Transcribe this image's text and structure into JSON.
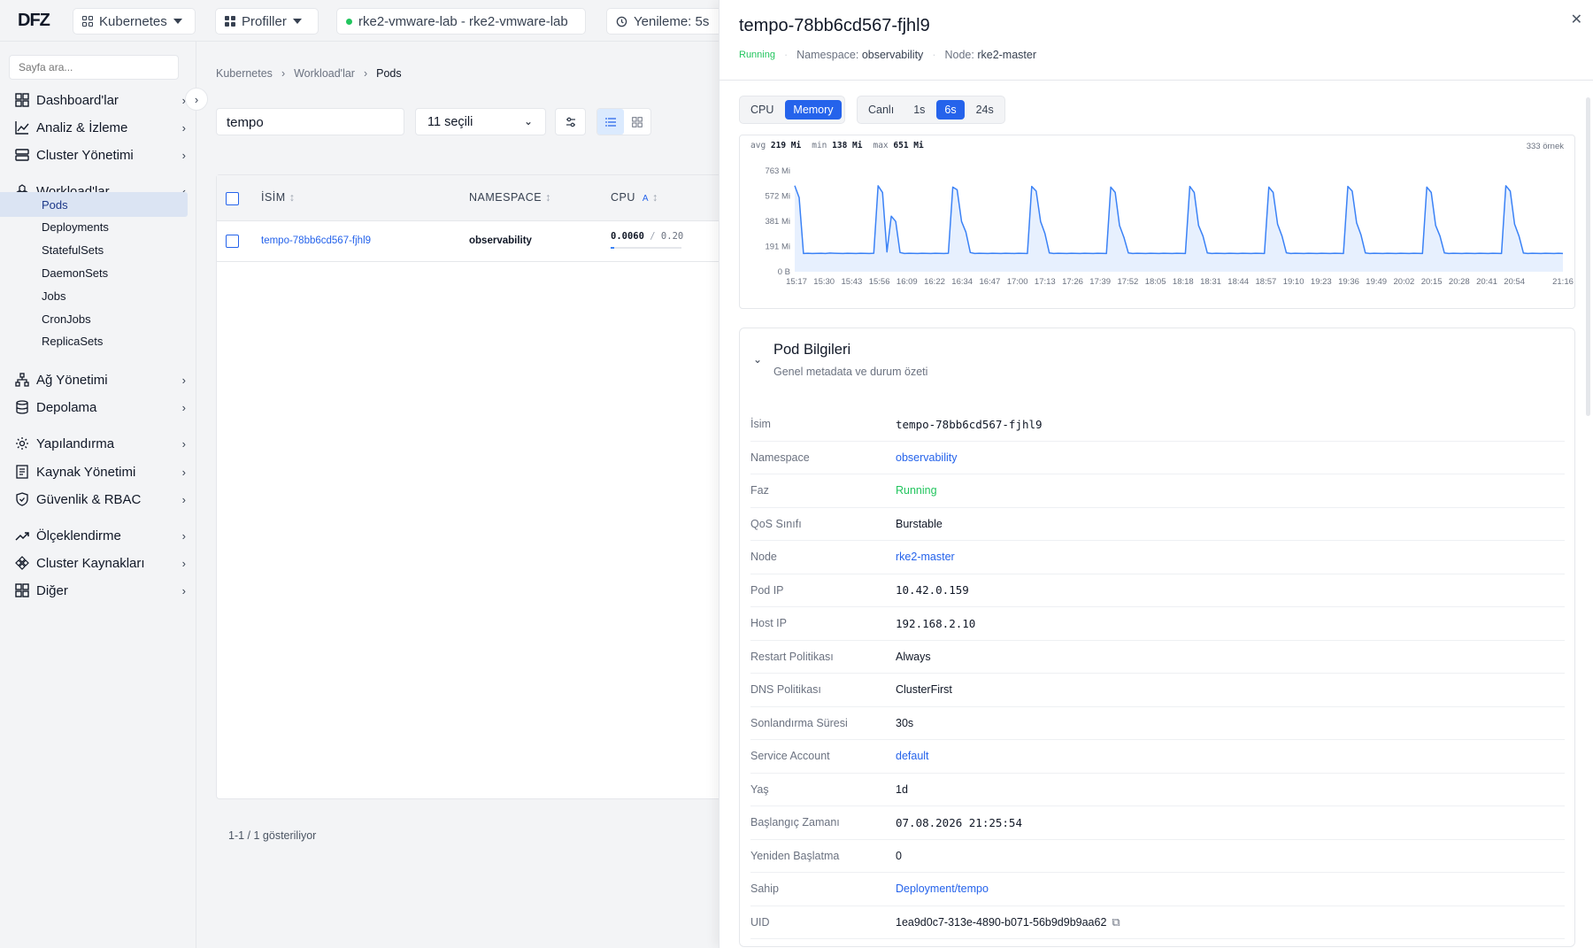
{
  "topbar": {
    "logo": "DFZ",
    "kubernetes_label": "Kubernetes",
    "profiles_label": "Profiller",
    "cluster_label": "rke2-vmware-lab - rke2-vmware-lab",
    "refresh_label": "Yenileme:  5s"
  },
  "sidebar": {
    "search_placeholder": "Sayfa ara...",
    "items": [
      {
        "label": "Dashboard'lar"
      },
      {
        "label": "Analiz & İzleme"
      },
      {
        "label": "Cluster Yönetimi"
      },
      {
        "label": "Workload'lar"
      },
      {
        "label": "Ağ Yönetimi"
      },
      {
        "label": "Depolama"
      },
      {
        "label": "Yapılandırma"
      },
      {
        "label": "Kaynak Yönetimi"
      },
      {
        "label": "Güvenlik & RBAC"
      },
      {
        "label": "Ölçeklendirme"
      },
      {
        "label": "Cluster Kaynakları"
      },
      {
        "label": "Diğer"
      }
    ],
    "workload_sub": [
      "Pods",
      "Deployments",
      "StatefulSets",
      "DaemonSets",
      "Jobs",
      "CronJobs",
      "ReplicaSets"
    ]
  },
  "main": {
    "breadcrumb": [
      "Kubernetes",
      "Workload'lar",
      "Pods"
    ],
    "filter_value": "tempo",
    "namespace_select": "11 seçili",
    "table": {
      "headers": [
        "İSİM",
        "NAMESPACE",
        "CPU"
      ],
      "cpu_sort_badge": "A",
      "rows": [
        {
          "name": "tempo-78bb6cd567-fjhl9",
          "namespace": "observability",
          "cpu_used": "0.0060",
          "cpu_sep": "/",
          "cpu_limit": "0.20"
        }
      ]
    },
    "footer": "1-1 / 1 gösteriliyor"
  },
  "drawer": {
    "title": "tempo-78bb6cd567-fjhl9",
    "status": "Running",
    "ns_label": "Namespace:",
    "ns_value": "observability",
    "node_label": "Node:",
    "node_value": "rke2-master",
    "metric_tabs": [
      "CPU",
      "Memory"
    ],
    "active_metric": "Memory",
    "range_tabs": [
      "Canlı",
      "1s",
      "6s",
      "24s"
    ],
    "active_range": "6s",
    "stats": {
      "avg_label": "avg",
      "avg": "219 Mi",
      "min_label": "min",
      "min": "138 Mi",
      "max_label": "max",
      "max": "651 Mi",
      "samples": "333 örnek"
    },
    "info": {
      "title": "Pod Bilgileri",
      "subtitle": "Genel metadata ve durum özeti",
      "rows": [
        {
          "k": "İsim",
          "v": "tempo-78bb6cd567-fjhl9",
          "style": "mono"
        },
        {
          "k": "Namespace",
          "v": "observability",
          "style": "link"
        },
        {
          "k": "Faz",
          "v": "Running",
          "style": "green"
        },
        {
          "k": "QoS Sınıfı",
          "v": "Burstable",
          "style": ""
        },
        {
          "k": "Node",
          "v": "rke2-master",
          "style": "link"
        },
        {
          "k": "Pod IP",
          "v": "10.42.0.159",
          "style": "mono"
        },
        {
          "k": "Host IP",
          "v": "192.168.2.10",
          "style": "mono"
        },
        {
          "k": "Restart Politikası",
          "v": "Always",
          "style": ""
        },
        {
          "k": "DNS Politikası",
          "v": "ClusterFirst",
          "style": ""
        },
        {
          "k": "Sonlandırma Süresi",
          "v": "30s",
          "style": ""
        },
        {
          "k": "Service Account",
          "v": "default",
          "style": "link"
        },
        {
          "k": "Yaş",
          "v": "1d",
          "style": ""
        },
        {
          "k": "Başlangıç Zamanı",
          "v": "07.08.2026 21:25:54",
          "style": "mono"
        },
        {
          "k": "Yeniden Başlatma",
          "v": "0",
          "style": ""
        },
        {
          "k": "Sahip",
          "v": "Deployment/tempo",
          "style": "link"
        },
        {
          "k": "UID",
          "v": "1ea9d0c7-313e-4890-b071-56b9d9b9aa62",
          "style": ""
        }
      ]
    }
  },
  "chart_data": {
    "type": "area",
    "title": "",
    "ylabel": "Memory",
    "y_ticks": [
      "763 Mi",
      "572 Mi",
      "381 Mi",
      "191 Mi",
      "0 B"
    ],
    "x_ticks": [
      "15:17",
      "15:30",
      "15:43",
      "15:56",
      "16:09",
      "16:22",
      "16:34",
      "16:47",
      "17:00",
      "17:13",
      "17:26",
      "17:39",
      "17:52",
      "18:05",
      "18:18",
      "18:31",
      "18:44",
      "18:57",
      "19:10",
      "19:23",
      "19:36",
      "19:49",
      "20:02",
      "20:15",
      "20:28",
      "20:41",
      "20:54",
      "21:16"
    ],
    "ylim": [
      0,
      763
    ],
    "color": "#3b82f6",
    "series": [
      {
        "values": [
          651,
          560,
          138,
          140,
          138,
          139,
          140,
          138,
          141,
          140,
          139,
          138,
          140,
          139,
          138,
          140,
          139,
          138,
          140,
          650,
          600,
          150,
          420,
          380,
          145,
          138,
          140,
          139,
          138,
          140,
          139,
          138,
          140,
          139,
          138,
          140,
          640,
          620,
          380,
          300,
          145,
          138,
          140,
          139,
          138,
          140,
          139,
          138,
          140,
          139,
          138,
          140,
          139,
          138,
          645,
          610,
          380,
          290,
          142,
          138,
          140,
          139,
          138,
          140,
          139,
          138,
          140,
          139,
          138,
          140,
          139,
          138,
          640,
          600,
          350,
          260,
          142,
          138,
          140,
          139,
          138,
          140,
          139,
          138,
          140,
          139,
          138,
          140,
          139,
          138,
          645,
          600,
          350,
          270,
          142,
          138,
          140,
          139,
          138,
          140,
          139,
          138,
          140,
          139,
          138,
          140,
          139,
          138,
          640,
          600,
          360,
          270,
          143,
          138,
          140,
          139,
          138,
          140,
          139,
          138,
          140,
          139,
          138,
          140,
          139,
          138,
          645,
          610,
          370,
          280,
          142,
          138,
          140,
          139,
          138,
          140,
          139,
          138,
          140,
          139,
          138,
          140,
          139,
          138,
          640,
          600,
          350,
          270,
          142,
          138,
          140,
          139,
          138,
          140,
          139,
          138,
          140,
          139,
          138,
          140,
          139,
          138,
          650,
          610,
          360,
          270,
          141,
          138,
          140,
          139,
          138,
          140,
          139,
          138,
          140,
          138
        ]
      }
    ]
  }
}
